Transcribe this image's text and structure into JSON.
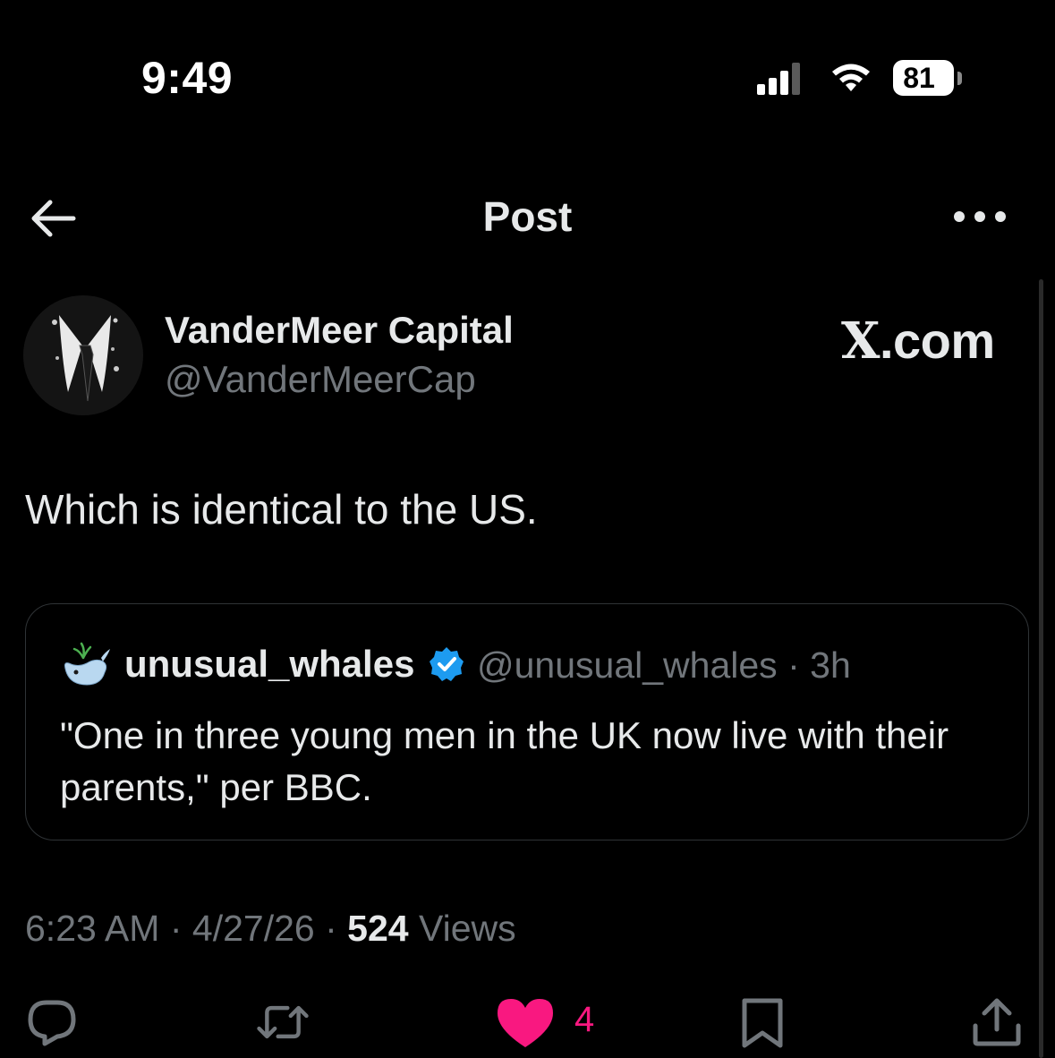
{
  "status_bar": {
    "time": "9:49",
    "battery": "81"
  },
  "header": {
    "title": "Post"
  },
  "author": {
    "display_name": "VanderMeer Capital",
    "handle": "@VanderMeerCap"
  },
  "watermark": {
    "x_mark": "X",
    "suffix": ".com"
  },
  "post": {
    "text": "Which is identical to the US."
  },
  "quote": {
    "display_name": "unusual_whales",
    "handle": "@unusual_whales",
    "separator": "·",
    "time": "3h",
    "text": "\"One in three young men in the UK now live with their parents,\" per BBC."
  },
  "meta": {
    "time": "6:23 AM",
    "separator": "·",
    "date": "4/27/26",
    "views_count": "524",
    "views_label": "Views"
  },
  "actions": {
    "like_count": "4"
  },
  "colors": {
    "background": "#000000",
    "text": "#e7e9ea",
    "muted": "#71767b",
    "like": "#f91880",
    "verified": "#1d9bf0",
    "border": "#2f3336"
  },
  "icons": {
    "back": "arrow-left-icon",
    "more": "more-dots-icon",
    "verified": "verified-badge-icon",
    "reply": "reply-icon",
    "repost": "repost-icon",
    "like": "heart-icon",
    "bookmark": "bookmark-icon",
    "share": "share-icon"
  }
}
